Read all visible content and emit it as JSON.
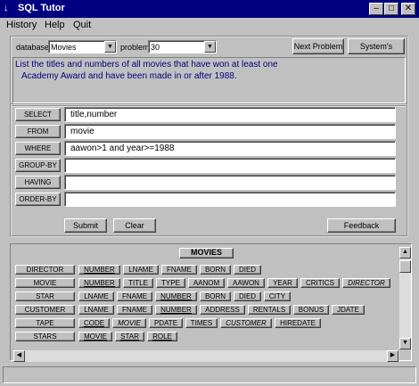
{
  "window": {
    "title": "SQL Tutor",
    "controls": [
      "minimize",
      "maximize",
      "close"
    ]
  },
  "menu": [
    "History",
    "Help",
    "Quit"
  ],
  "top_bar": {
    "database_label": "database",
    "database_value": "Movies",
    "problem_label": "problem",
    "problem_value": "30",
    "next_problem": "Next Problem",
    "systems_choice": "System's Choice"
  },
  "problem_text_line1": "List the titles and numbers of all movies that have won at least one",
  "problem_text_line2": "Academy Award and have been made in or after 1988.",
  "clauses": [
    {
      "label": "SELECT",
      "value": "title,number"
    },
    {
      "label": "FROM",
      "value": "movie"
    },
    {
      "label": "WHERE",
      "value": "aawon>1 and year>=1988"
    },
    {
      "label": "GROUP-BY",
      "value": ""
    },
    {
      "label": "HAVING",
      "value": ""
    },
    {
      "label": "ORDER-BY",
      "value": ""
    }
  ],
  "actions": {
    "submit": "Submit",
    "clear": "Clear",
    "feedback": "Feedback"
  },
  "schema": {
    "db_name": "MOVIES",
    "tables": [
      {
        "name": "DIRECTOR",
        "attrs": [
          {
            "t": "NUMBER",
            "u": true
          },
          {
            "t": "LNAME"
          },
          {
            "t": "FNAME"
          },
          {
            "t": "BORN"
          },
          {
            "t": "DIED"
          }
        ]
      },
      {
        "name": "MOVIE",
        "attrs": [
          {
            "t": "NUMBER",
            "u": true
          },
          {
            "t": "TITLE"
          },
          {
            "t": "TYPE"
          },
          {
            "t": "AANOM"
          },
          {
            "t": "AAWON"
          },
          {
            "t": "YEAR"
          },
          {
            "t": "CRITICS"
          },
          {
            "t": "DIRECTOR",
            "i": true
          }
        ]
      },
      {
        "name": "STAR",
        "attrs": [
          {
            "t": "LNAME"
          },
          {
            "t": "FNAME"
          },
          {
            "t": "NUMBER",
            "u": true
          },
          {
            "t": "BORN"
          },
          {
            "t": "DIED"
          },
          {
            "t": "CITY"
          }
        ]
      },
      {
        "name": "CUSTOMER",
        "attrs": [
          {
            "t": "LNAME"
          },
          {
            "t": "FNAME"
          },
          {
            "t": "NUMBER",
            "u": true
          },
          {
            "t": "ADDRESS"
          },
          {
            "t": "RENTALS"
          },
          {
            "t": "BONUS"
          },
          {
            "t": "JDATE"
          }
        ]
      },
      {
        "name": "TAPE",
        "attrs": [
          {
            "t": "CODE",
            "u": true
          },
          {
            "t": "MOVIE",
            "i": true
          },
          {
            "t": "PDATE"
          },
          {
            "t": "TIMES"
          },
          {
            "t": "CUSTOMER",
            "i": true
          },
          {
            "t": "HIREDATE"
          }
        ]
      },
      {
        "name": "STARS",
        "attrs": [
          {
            "t": "MOVIE",
            "u": true
          },
          {
            "t": "STAR",
            "u": true
          },
          {
            "t": "ROLE",
            "u": true
          }
        ]
      }
    ]
  }
}
